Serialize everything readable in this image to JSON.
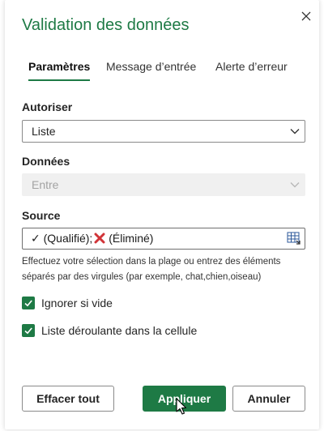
{
  "dialog": {
    "title": "Validation des données",
    "close_icon": "close-icon"
  },
  "tabs": [
    {
      "label": "Paramètres",
      "active": true
    },
    {
      "label": "Message d’entrée",
      "active": false
    },
    {
      "label": "Alerte d’erreur",
      "active": false
    }
  ],
  "allow": {
    "label": "Autoriser",
    "value": "Liste"
  },
  "data_field": {
    "label": "Données",
    "value": "Entre",
    "disabled": true
  },
  "source": {
    "label": "Source",
    "value_part1": "✓ (Qualifié);",
    "value_part2": " (Éliminé)",
    "range_icon": "range-select-icon"
  },
  "help_text": "Effectuez votre sélection dans la plage ou entrez des éléments séparés par des virgules (par exemple, chat,chien,oiseau)",
  "options": {
    "ignore_blank": {
      "label": "Ignorer si vide",
      "checked": true
    },
    "in_cell_dropdown": {
      "label": "Liste déroulante dans la cellule",
      "checked": true
    }
  },
  "buttons": {
    "clear_all": "Effacer tout",
    "apply": "Appliquer",
    "cancel": "Annuler"
  },
  "colors": {
    "accent": "#1e7a45",
    "cross": "#d13438"
  }
}
